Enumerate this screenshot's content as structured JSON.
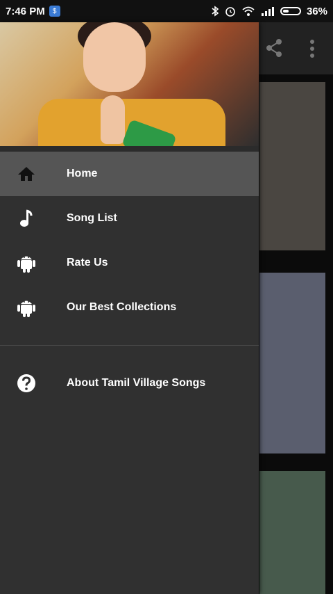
{
  "status_bar": {
    "time": "7:46 PM",
    "badge": "$",
    "battery_percent": "36%",
    "battery_level": 0.36
  },
  "drawer": {
    "header_image": "girl-namaste-photo",
    "menu": [
      {
        "label": "Home",
        "icon": "home-icon",
        "active": true
      },
      {
        "label": "Song List",
        "icon": "music-note-icon",
        "active": false
      },
      {
        "label": "Rate Us",
        "icon": "android-icon",
        "active": false
      },
      {
        "label": "Our Best Collections",
        "icon": "android-icon",
        "active": false
      }
    ],
    "secondary_menu": [
      {
        "label": "About Tamil Village Songs",
        "icon": "help-icon"
      }
    ]
  },
  "colors": {
    "drawer_bg": "#303030",
    "active_item_bg": "#555555",
    "text": "#ffffff"
  }
}
